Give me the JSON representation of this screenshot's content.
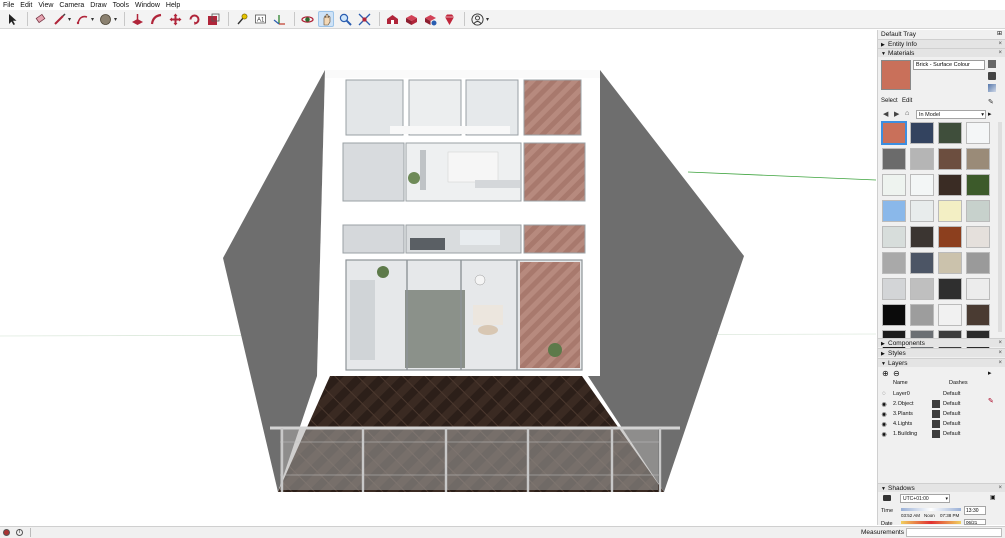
{
  "menu": [
    "File",
    "Edit",
    "View",
    "Camera",
    "Draw",
    "Tools",
    "Window",
    "Help"
  ],
  "toolbar": {
    "tools": [
      "select-icon",
      "eraser-icon",
      "line-icon",
      "arc-icon",
      "shape-icon",
      "push-pull-icon",
      "follow-me-icon",
      "move-icon",
      "rotate-icon",
      "scale-icon",
      "tape-measure-icon",
      "text-icon",
      "axes-icon",
      "orbit-icon",
      "pan-icon",
      "zoom-icon",
      "zoom-extents-icon",
      "warehouse-icon",
      "extension-icon",
      "extension-manager-icon",
      "ruby-icon",
      "account-icon"
    ]
  },
  "tray": {
    "title": "Default Tray",
    "entity_info": "Entity Info",
    "materials": {
      "header": "Materials",
      "current_name": "Brick - Surface Colour",
      "tab_select": "Select",
      "tab_edit": "Edit",
      "collection": "In Model",
      "swatch_colors": [
        "#c9705a",
        "#33435f",
        "#3f4e3b",
        "#f4f6f7",
        "#6b6b6b",
        "#b5b5b5",
        "#6c4e3f",
        "#9a8b78",
        "#eef3ef",
        "#f3f6f6",
        "#3a2c24",
        "#3c5a2a",
        "#8ab8ea",
        "#e8ecec",
        "#f3efc4",
        "#c7d1cc",
        "#d7dddb",
        "#3b3531",
        "#8c3f1e",
        "#e5e0dc",
        "#a9a9a9",
        "#4c5565",
        "#cbc2ac",
        "#9a9a9a",
        "#d3d5d7",
        "#bfbfbf",
        "#2f2f2f",
        "#ececec",
        "#0b0b0b",
        "#9d9d9d",
        "#f1f1f1",
        "#4a3b32",
        "#1c1c1c",
        "#6b6f73",
        "#3c3c3c",
        "#2a2a2a"
      ]
    },
    "components": "Components",
    "styles": "Styles",
    "layers": {
      "header": "Layers",
      "col_name": "Name",
      "col_dashes": "Dashes",
      "rows": [
        {
          "name": "Layer0",
          "dashes": "Default"
        },
        {
          "name": "2.Object",
          "dashes": "Default"
        },
        {
          "name": "3.Plants",
          "dashes": "Default"
        },
        {
          "name": "4.Lights",
          "dashes": "Default"
        },
        {
          "name": "1.Building",
          "dashes": "Default"
        }
      ]
    },
    "shadows": {
      "header": "Shadows",
      "timezone": "UTC+01:00",
      "time_label": "Time",
      "time_start": "03:52 AM",
      "time_noon": "Noon",
      "time_end": "07:38 PM",
      "time_value": "13:30",
      "date_label": "Date",
      "date_value": "06/21"
    }
  },
  "status": {
    "measurements_label": "Measurements"
  }
}
